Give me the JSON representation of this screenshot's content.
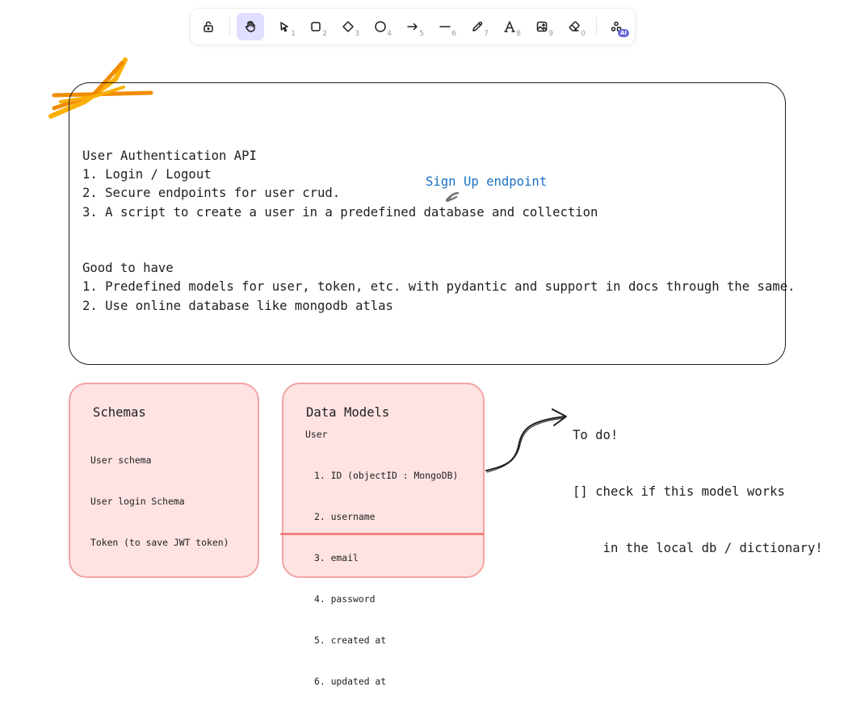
{
  "toolbar": {
    "tools": [
      {
        "name": "lock",
        "key": ""
      },
      {
        "name": "hand",
        "key": ""
      },
      {
        "name": "selection",
        "key": "1"
      },
      {
        "name": "rectangle",
        "key": "2"
      },
      {
        "name": "diamond",
        "key": "3"
      },
      {
        "name": "ellipse",
        "key": "4"
      },
      {
        "name": "arrow",
        "key": "5"
      },
      {
        "name": "line",
        "key": "6"
      },
      {
        "name": "draw",
        "key": "7"
      },
      {
        "name": "text",
        "key": "8"
      },
      {
        "name": "image",
        "key": "9"
      },
      {
        "name": "eraser",
        "key": "0"
      },
      {
        "name": "more-shapes",
        "key": ""
      }
    ],
    "active_tool": "hand",
    "ai_badge": "AI"
  },
  "canvas": {
    "main_note": {
      "lines": [
        "User Authentication API",
        "1. Login / Logout",
        "2. Secure endpoints for user crud.",
        "3. A script to create a user in a predefined database and collection",
        "",
        "",
        "Good to have",
        "1. Predefined models for user, token, etc. with pydantic and support in docs through the same.",
        "2. Use online database like mongodb atlas"
      ]
    },
    "signup_annotation": "Sign Up endpoint",
    "schemas": {
      "title": "Schemas",
      "items": [
        "User schema",
        "User login Schema",
        "Token (to save JWT token)"
      ]
    },
    "data_models": {
      "title": "Data Models",
      "subtitle": "User",
      "fields": [
        "1. ID (objectID : MongoDB)",
        "2. username",
        "3. email",
        "4. password",
        "5. created at",
        "6. updated at"
      ]
    },
    "todo": {
      "lines": [
        "To do!",
        "[] check if this model works",
        "    in the local db / dictionary!"
      ]
    }
  },
  "colors": {
    "accent": "#6965db",
    "active_tool_bg": "#e0dfff",
    "annotation_blue": "#1971c2",
    "pink_fill": "#ffe3e3",
    "pink_stroke": "#f4a3a3",
    "scribble_orange": "#f08c00",
    "scribble_yellow": "#fab005"
  }
}
